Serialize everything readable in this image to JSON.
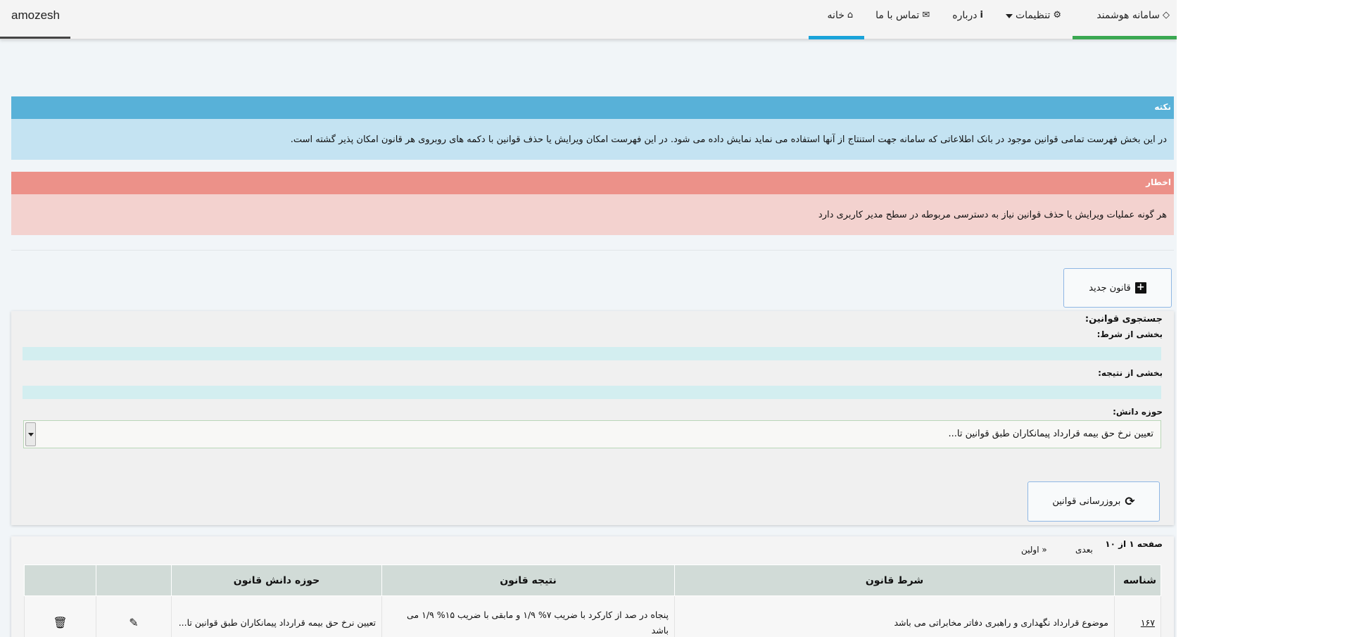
{
  "navbar": {
    "brand": "amozesh",
    "items": [
      {
        "label": "سامانه هوشمند",
        "icon": "diamond-icon",
        "glyph": "💎",
        "dropdown": false
      },
      {
        "label": "تنظیمات",
        "icon": "gear-icon",
        "glyph": "⚙",
        "dropdown": true
      },
      {
        "label": "درباره",
        "icon": "info-icon",
        "glyph": "ℹ",
        "dropdown": false
      },
      {
        "label": "تماس با ما",
        "icon": "envelope-icon",
        "glyph": "✉",
        "dropdown": false
      },
      {
        "label": "خانه",
        "icon": "home-icon",
        "glyph": "⌂",
        "dropdown": false,
        "active": true
      }
    ]
  },
  "info_panel": {
    "title": "نکته",
    "text": "در این بخش فهرست تمامی قوانین موجود در بانک اطلاعاتی که سامانه جهت استنتاج از آنها استفاده می نماید نمایش داده می شود. در این فهرست امکان ویرایش یا حذف قوانین با دکمه های روبروی هر قانون امکان پذیر گشته است."
  },
  "danger_panel": {
    "title": "اخطار",
    "text": "هر گونه عملیات ویرایش یا حذف قوانین نیاز به دسترسی مربوطه در سطح مدیر کاربری دارد"
  },
  "new_rule_button": {
    "label": "قانون جدید",
    "icon": "plus-square-icon"
  },
  "search": {
    "title": "جستجوی قوانین:",
    "condition_label": "بخشی از شرط:",
    "condition_value": "",
    "result_label": "بخشی از نتیجه:",
    "result_value": "",
    "domain_label": "حوزه دانش:",
    "domain_selected": "تعیین نرخ حق بیمه قرارداد پیمانکاران طبق قوانین تا...",
    "refresh_label": "بروزرسانی قوانین",
    "refresh_icon": "refresh-icon"
  },
  "pager": {
    "info": "صفحه ۱ از ۱۰",
    "next": "بعدی",
    "first": "« اولین"
  },
  "table": {
    "headers": [
      "شناسه",
      "شرط قانون",
      "نتیجه قانون",
      "حوزه دانش قانون",
      "",
      ""
    ],
    "rows": [
      {
        "id": "۱۶۷",
        "condition": "موضوع قرارداد نگهداری و راهبری دفاتر مخابراتی می باشد",
        "result": "پنجاه در صد از کارکرد با ضریب ۷% ۱/۹ و مابقی با ضریب ۱۵% ۱/۹ می باشد",
        "domain": "تعیین نرخ حق بیمه قرارداد پیمانکاران طبق قوانین تا...",
        "edit_icon": "edit-icon",
        "delete_icon": "trash-icon"
      }
    ]
  }
}
